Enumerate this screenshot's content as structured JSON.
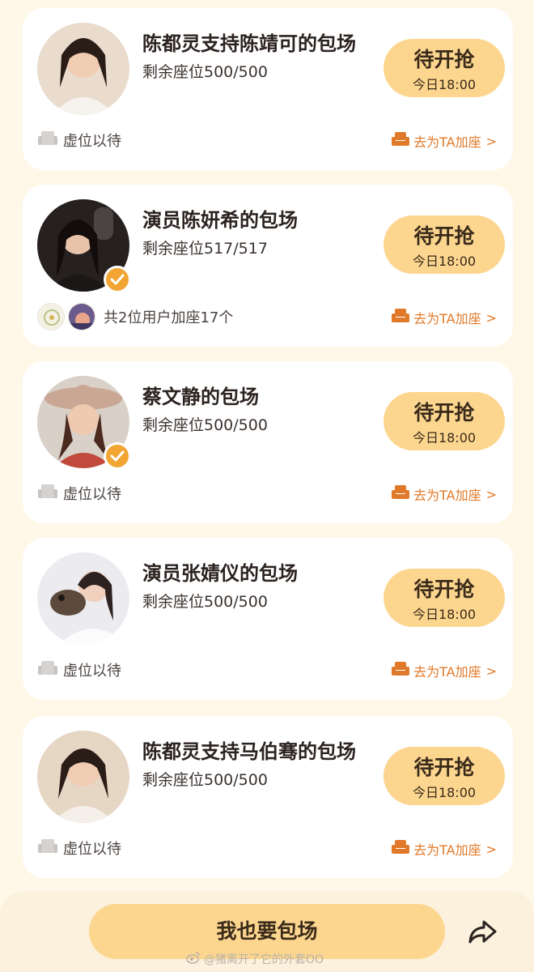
{
  "colors": {
    "page_bg": "#FFF8E8",
    "card_bg": "#FFFFFF",
    "accent_button": "#FCD68F",
    "link_orange": "#E07A2A",
    "verified_badge": "#F2A532"
  },
  "cards": [
    {
      "title": "陈都灵支持陈靖可的包场",
      "seats": "剩余座位500/500",
      "button_label": "待开抢",
      "button_time": "今日18:00",
      "status_text": "虚位以待",
      "join_link": "去为TA加座",
      "chevron": ">",
      "verified": false
    },
    {
      "title": "演员陈妍希的包场",
      "seats": "剩余座位517/517",
      "button_label": "待开抢",
      "button_time": "今日18:00",
      "status_text": "共2位用户加座17个",
      "join_link": "去为TA加座",
      "chevron": ">",
      "verified": true
    },
    {
      "title": "蔡文静的包场",
      "seats": "剩余座位500/500",
      "button_label": "待开抢",
      "button_time": "今日18:00",
      "status_text": "虚位以待",
      "join_link": "去为TA加座",
      "chevron": ">",
      "verified": true
    },
    {
      "title": "演员张婧仪的包场",
      "seats": "剩余座位500/500",
      "button_label": "待开抢",
      "button_time": "今日18:00",
      "status_text": "虚位以待",
      "join_link": "去为TA加座",
      "chevron": ">",
      "verified": false
    },
    {
      "title": "陈都灵支持马伯骞的包场",
      "seats": "剩余座位500/500",
      "button_label": "待开抢",
      "button_time": "今日18:00",
      "status_text": "虚位以待",
      "join_link": "去为TA加座",
      "chevron": ">",
      "verified": false
    }
  ],
  "footer": {
    "cta_label": "我也要包场",
    "share_icon": "share-icon",
    "watermark": "@猪离开了它的外套OO"
  }
}
